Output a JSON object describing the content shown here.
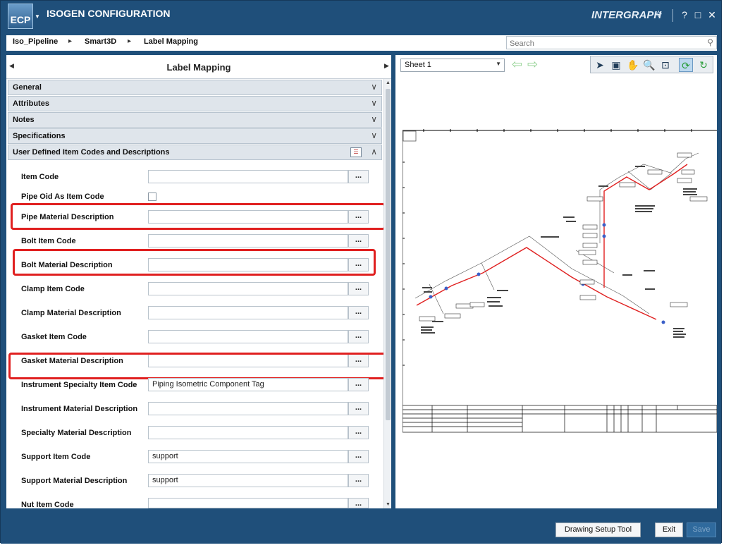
{
  "app": {
    "logo_text": "ECP",
    "title": "ISOGEN CONFIGURATION",
    "brand": "INTERGRAPH",
    "window_controls": {
      "help": "?",
      "maximize": "□",
      "close": "✕"
    }
  },
  "breadcrumb": [
    "Iso_Pipeline",
    "Smart3D",
    "Label Mapping"
  ],
  "search": {
    "placeholder": "Search"
  },
  "left_panel": {
    "title": "Label Mapping",
    "sections": [
      {
        "label": "General"
      },
      {
        "label": "Attributes"
      },
      {
        "label": "Notes"
      },
      {
        "label": "Specifications"
      },
      {
        "label": "User Defined Item Codes and Descriptions",
        "expanded": true
      }
    ],
    "browse_label": "...",
    "fields": [
      {
        "label": "Item Code",
        "value": ""
      },
      {
        "label": "Pipe Oid As Item Code",
        "value": "",
        "type": "checkbox"
      },
      {
        "label": "Pipe Material Description",
        "value": ""
      },
      {
        "label": "Bolt Item Code",
        "value": ""
      },
      {
        "label": "Bolt Material Description",
        "value": ""
      },
      {
        "label": "Clamp Item Code",
        "value": ""
      },
      {
        "label": "Clamp Material Description",
        "value": ""
      },
      {
        "label": "Gasket Item Code",
        "value": ""
      },
      {
        "label": "Gasket Material Description",
        "value": ""
      },
      {
        "label": "Instrument Specialty Item Code",
        "value": "Piping Isometric Component Tag"
      },
      {
        "label": "Instrument Material Description",
        "value": ""
      },
      {
        "label": "Specialty Material Description",
        "value": ""
      },
      {
        "label": "Support Item Code",
        "value": "support"
      },
      {
        "label": "Support Material Description",
        "value": "support"
      },
      {
        "label": "Nut Item Code",
        "value": ""
      }
    ]
  },
  "right_panel": {
    "sheet_select": "Sheet 1",
    "tools": [
      "select-arrow-icon",
      "fit-icon",
      "pan-hand-icon",
      "zoom-icon",
      "zoom-window-icon",
      "refresh-icon",
      "rotate-icon"
    ]
  },
  "footer": {
    "drawing_setup_tool": "Drawing Setup Tool",
    "exit": "Exit",
    "save": "Save"
  },
  "colors": {
    "chrome": "#1f4f7a",
    "highlight": "#e02020",
    "pipe": "#e02020"
  }
}
